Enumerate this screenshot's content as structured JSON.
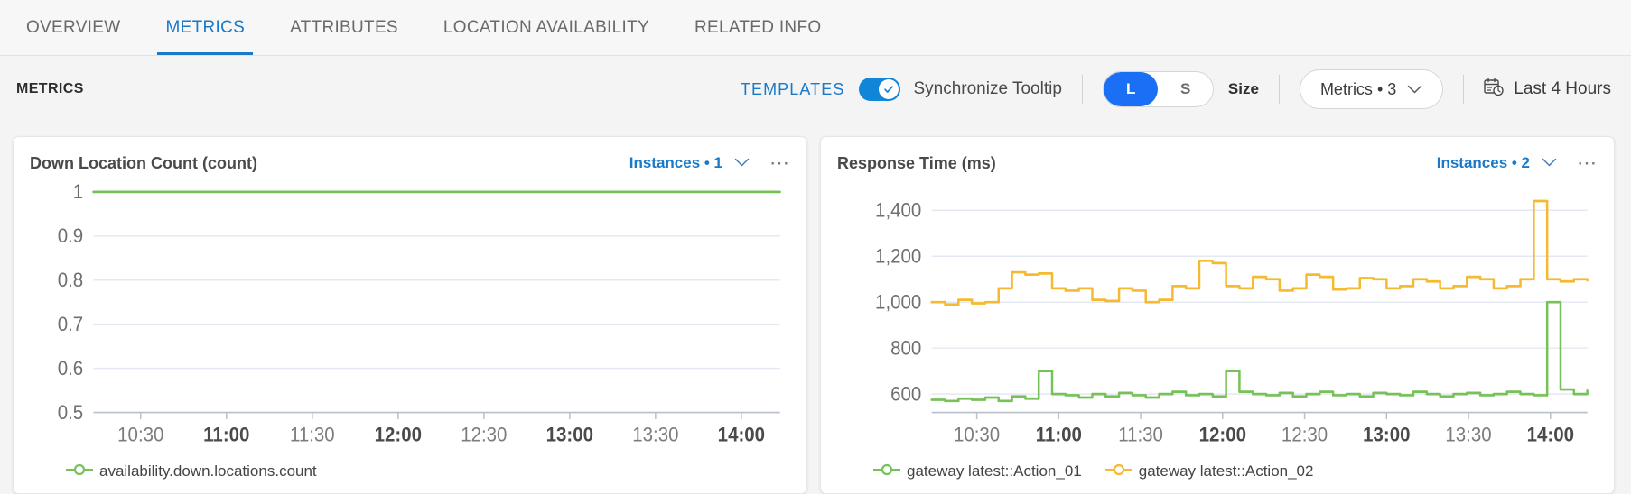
{
  "nav": {
    "tabs": [
      {
        "label": "OVERVIEW",
        "active": false
      },
      {
        "label": "METRICS",
        "active": true
      },
      {
        "label": "ATTRIBUTES",
        "active": false
      },
      {
        "label": "LOCATION AVAILABILITY",
        "active": false
      },
      {
        "label": "RELATED INFO",
        "active": false
      }
    ]
  },
  "toolbar": {
    "title": "METRICS",
    "templates_label": "TEMPLATES",
    "sync_tooltip_label": "Synchronize Tooltip",
    "sync_tooltip_on": true,
    "size_options": [
      "L",
      "S"
    ],
    "size_selected": "L",
    "size_label": "Size",
    "metrics_select_label": "Metrics • 3",
    "time_range_label": "Last 4 Hours",
    "time_range_icon": "calendar-clock-icon",
    "accent_color": "#1a79c8",
    "toggle_color": "#1186d8",
    "size_selected_color": "#1a6ff5"
  },
  "charts": [
    {
      "title": "Down Location Count (count)",
      "instances_label": "Instances • 1",
      "menu_icon": "ellipsis-icon",
      "chart_data": {
        "type": "line",
        "title": "Down Location Count (count)",
        "xlabel": "",
        "ylabel": "count",
        "ylim": [
          0.5,
          1.0
        ],
        "ytick_labels": [
          "1",
          "0.9",
          "0.8",
          "0.7",
          "0.6",
          "0.5"
        ],
        "yticks": [
          1,
          0.9,
          0.8,
          0.7,
          0.6,
          0.5
        ],
        "xtick_labels": [
          "10:30",
          "11:00",
          "11:30",
          "12:00",
          "12:30",
          "13:00",
          "13:30",
          "14:00"
        ],
        "xtick_bold": [
          false,
          true,
          false,
          true,
          false,
          true,
          false,
          true
        ],
        "grid": true,
        "legend_position": "bottom",
        "series": [
          {
            "name": "availability.down.locations.count",
            "color": "#77c159",
            "values": [
              1,
              1,
              1,
              1,
              1,
              1,
              1,
              1,
              1,
              1,
              1,
              1,
              1,
              1,
              1,
              1,
              1,
              1,
              1,
              1,
              1,
              1,
              1,
              1,
              1,
              1,
              1,
              1,
              1,
              1,
              1,
              1,
              1,
              1,
              1,
              1,
              1,
              1,
              1,
              1,
              1,
              1,
              1,
              1,
              1,
              1,
              1,
              1,
              1,
              1
            ]
          }
        ]
      }
    },
    {
      "title": "Response Time (ms)",
      "instances_label": "Instances • 2",
      "menu_icon": "ellipsis-icon",
      "chart_data": {
        "type": "line",
        "title": "Response Time (ms)",
        "xlabel": "",
        "ylabel": "ms",
        "ylim": [
          520,
          1480
        ],
        "ytick_labels": [
          "1,400",
          "1,200",
          "1,000",
          "800",
          "600"
        ],
        "yticks": [
          1400,
          1200,
          1000,
          800,
          600
        ],
        "xtick_labels": [
          "10:30",
          "11:00",
          "11:30",
          "12:00",
          "12:30",
          "13:00",
          "13:30",
          "14:00"
        ],
        "xtick_bold": [
          false,
          true,
          false,
          true,
          false,
          true,
          false,
          true
        ],
        "grid": true,
        "legend_position": "bottom",
        "series": [
          {
            "name": "gateway latest::Action_01",
            "color": "#77c159",
            "values": [
              575,
              570,
              580,
              575,
              585,
              570,
              590,
              580,
              700,
              600,
              595,
              585,
              600,
              590,
              605,
              595,
              585,
              600,
              610,
              595,
              600,
              590,
              700,
              610,
              600,
              595,
              605,
              590,
              600,
              610,
              595,
              600,
              590,
              605,
              600,
              595,
              610,
              600,
              590,
              600,
              605,
              595,
              600,
              610,
              600,
              595,
              1000,
              620,
              600,
              615
            ]
          },
          {
            "name": "gateway latest::Action_02",
            "color": "#f5ba31",
            "values": [
              1000,
              990,
              1010,
              995,
              1000,
              1060,
              1130,
              1120,
              1125,
              1060,
              1050,
              1060,
              1010,
              1005,
              1060,
              1050,
              1000,
              1010,
              1070,
              1060,
              1180,
              1170,
              1070,
              1060,
              1110,
              1100,
              1050,
              1060,
              1120,
              1110,
              1055,
              1060,
              1105,
              1100,
              1060,
              1070,
              1100,
              1090,
              1060,
              1070,
              1110,
              1100,
              1060,
              1070,
              1100,
              1440,
              1100,
              1090,
              1100,
              1095
            ]
          }
        ]
      }
    }
  ]
}
